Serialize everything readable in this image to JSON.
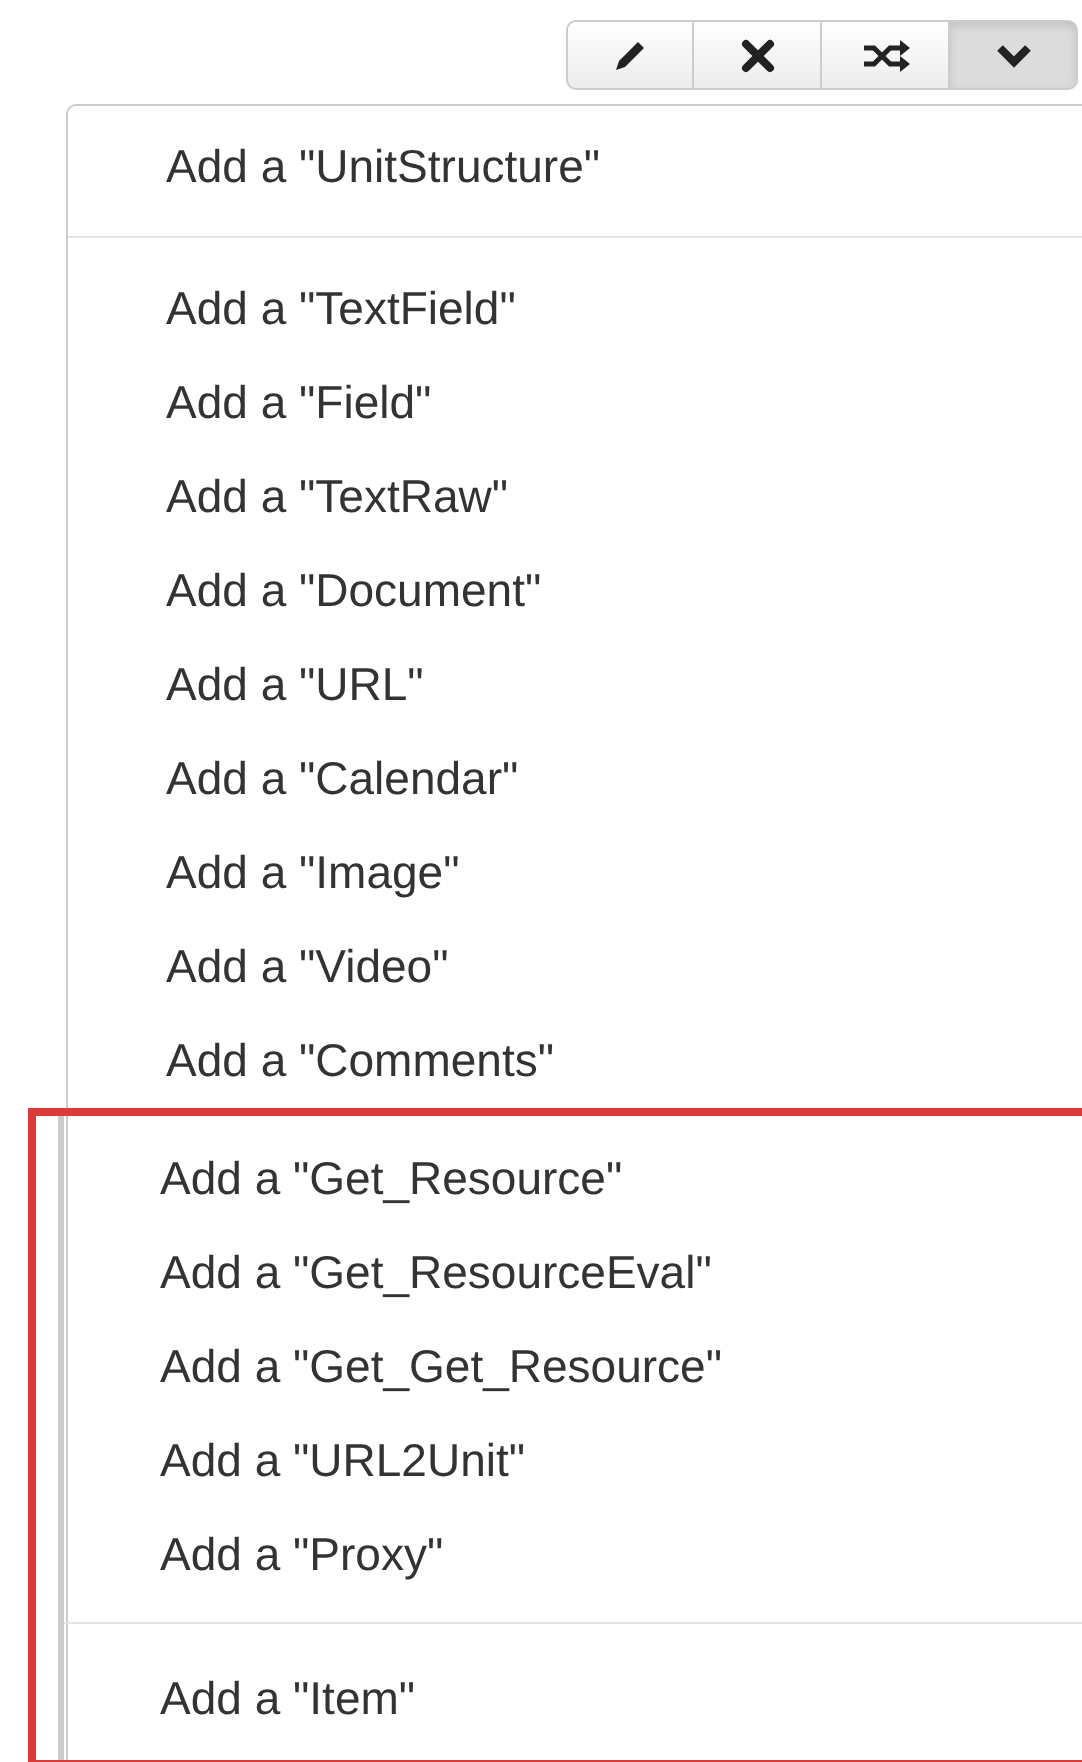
{
  "toolbar": [
    {
      "kind": "edit",
      "pressed": false
    },
    {
      "kind": "delete",
      "pressed": false
    },
    {
      "kind": "shuffle",
      "pressed": false
    },
    {
      "kind": "dropdown",
      "pressed": true
    }
  ],
  "menu": {
    "sections": [
      {
        "items": [
          "Add a \"UnitStructure\""
        ]
      },
      {
        "items": [
          "Add a \"TextField\"",
          "Add a \"Field\"",
          "Add a \"TextRaw\"",
          "Add a \"Document\"",
          "Add a \"URL\"",
          "Add a \"Calendar\"",
          "Add a \"Image\"",
          "Add a \"Video\"",
          "Add a \"Comments\""
        ]
      }
    ],
    "highlighted_sections": [
      {
        "items": [
          "Add a \"Get_Resource\"",
          "Add a \"Get_ResourceEval\"",
          "Add a \"Get_Get_Resource\"",
          "Add a \"URL2Unit\"",
          "Add a \"Proxy\""
        ]
      },
      {
        "items": [
          "Add a \"Item\""
        ]
      }
    ]
  }
}
